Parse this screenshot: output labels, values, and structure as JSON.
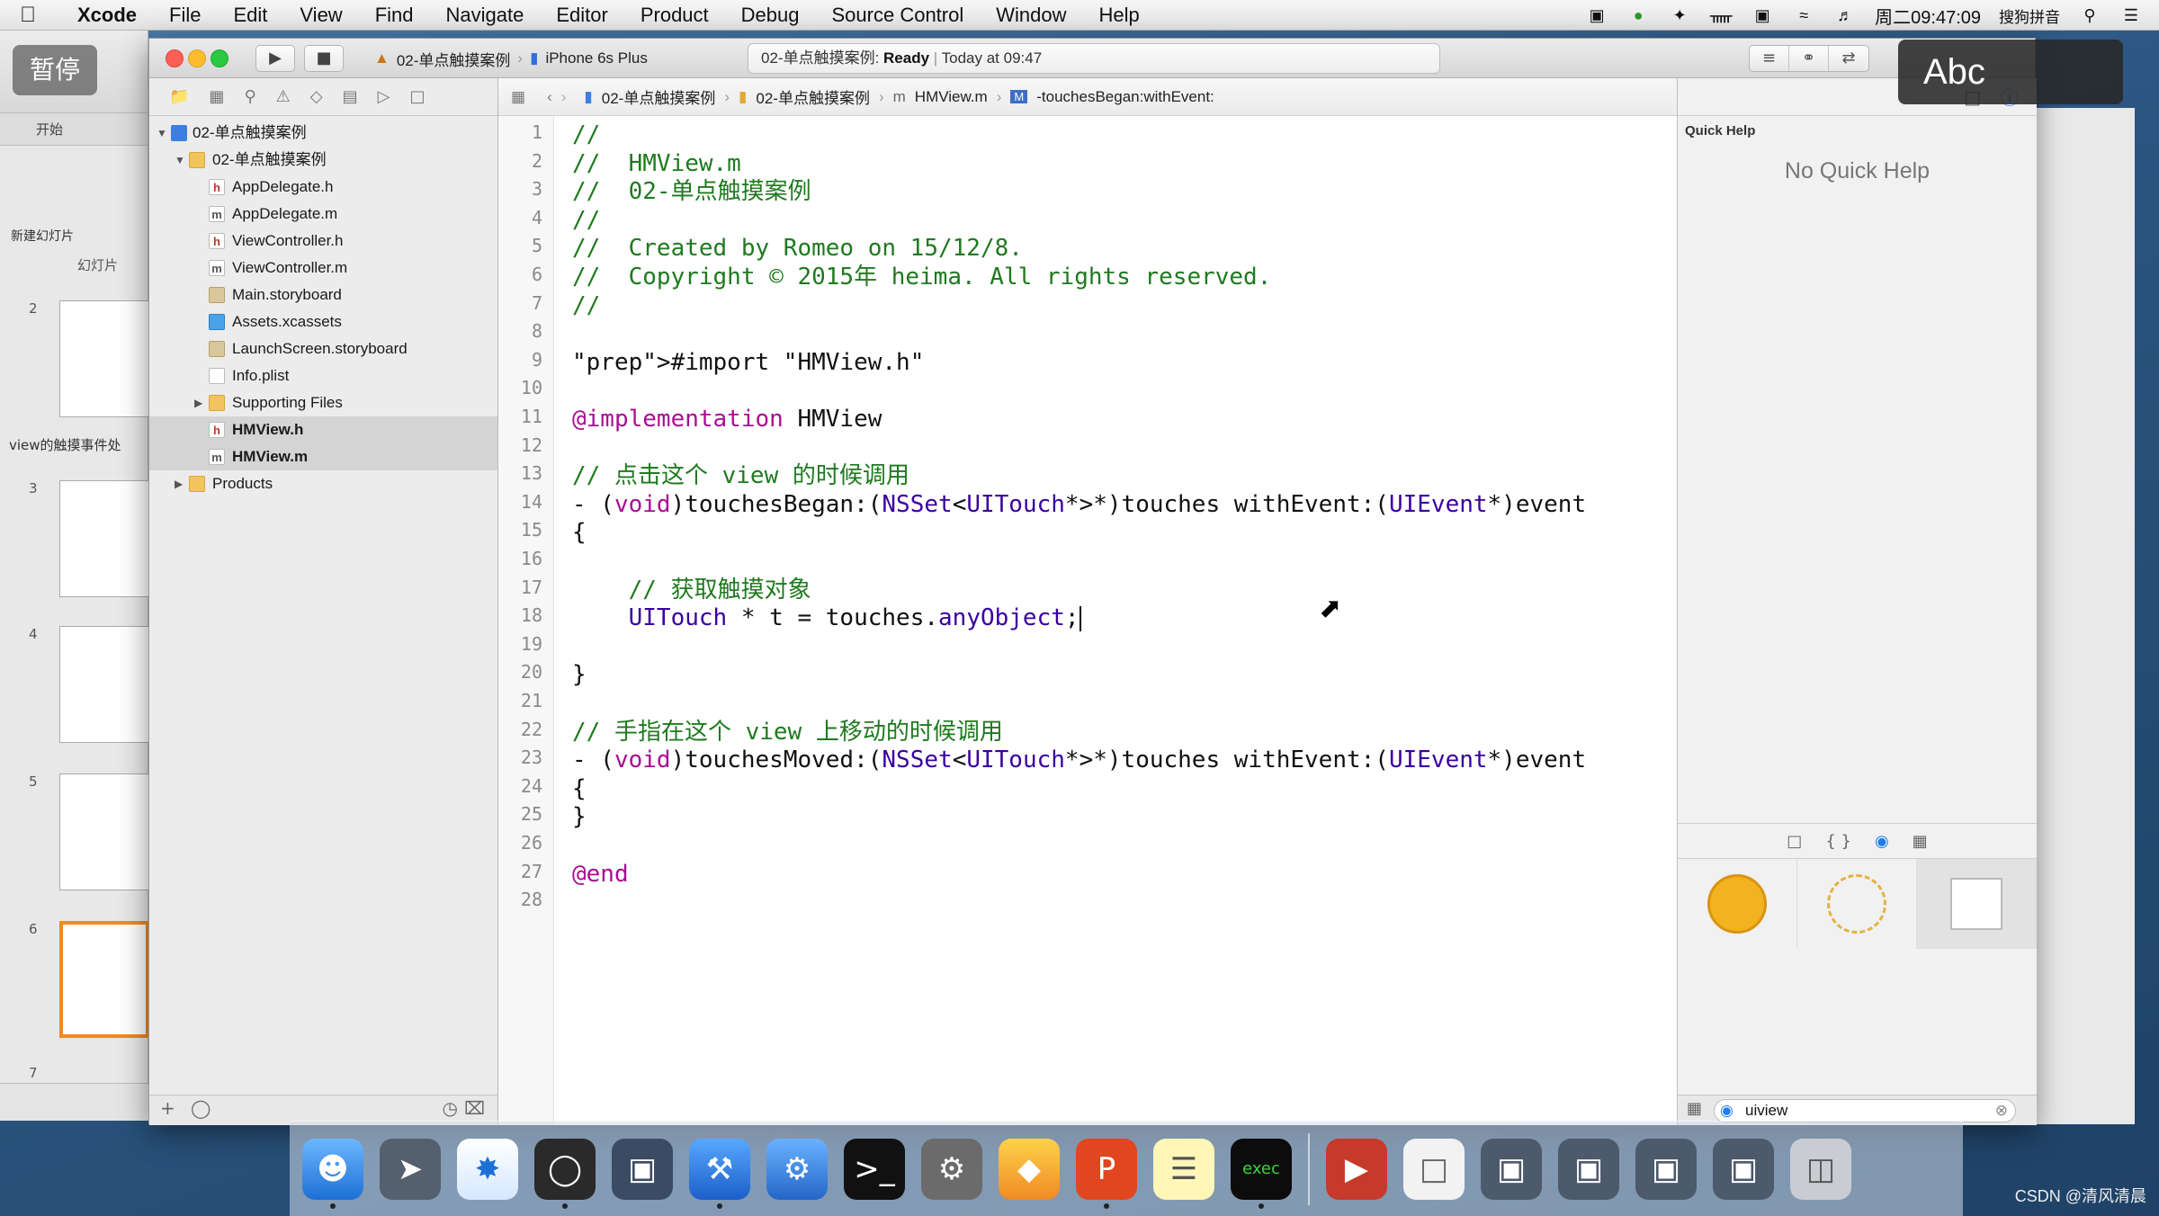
{
  "menubar": {
    "app": "Xcode",
    "items": [
      "File",
      "Edit",
      "View",
      "Find",
      "Navigate",
      "Editor",
      "Product",
      "Debug",
      "Source Control",
      "Window",
      "Help"
    ],
    "clock": "周二09:47:09",
    "input_method": "搜狗拼音"
  },
  "overlay": {
    "pause": "暂停",
    "abc": "Abc"
  },
  "keynote": {
    "tab_start": "开始",
    "tab_slides": "幻灯片",
    "new_slide": "新建幻灯片",
    "section_label": "view的触摸事件处",
    "slide_numbers": [
      "2",
      "3",
      "4",
      "5",
      "6",
      "7"
    ]
  },
  "toolbar": {
    "scheme": "02-单点触摸案例",
    "device": "iPhone 6s Plus",
    "status_project": "02-单点触摸案例:",
    "status_state": "Ready",
    "status_time": "Today at 09:47"
  },
  "jumpbar": [
    "02-单点触摸案例",
    "02-单点触摸案例",
    "HMView.m",
    "-touchesBegan:withEvent:"
  ],
  "navigator": {
    "project": "02-单点触摸案例",
    "group": "02-单点触摸案例",
    "files": [
      {
        "name": "AppDelegate.h",
        "type": "h"
      },
      {
        "name": "AppDelegate.m",
        "type": "m"
      },
      {
        "name": "ViewController.h",
        "type": "h"
      },
      {
        "name": "ViewController.m",
        "type": "m"
      },
      {
        "name": "Main.storyboard",
        "type": "sb"
      },
      {
        "name": "Assets.xcassets",
        "type": "xc"
      },
      {
        "name": "LaunchScreen.storyboard",
        "type": "sb"
      },
      {
        "name": "Info.plist",
        "type": "pl"
      },
      {
        "name": "Supporting Files",
        "type": "folder"
      },
      {
        "name": "HMView.h",
        "type": "h"
      },
      {
        "name": "HMView.m",
        "type": "m"
      }
    ],
    "products": "Products"
  },
  "editor": {
    "lines": [
      "//",
      "//  HMView.m",
      "//  02-单点触摸案例",
      "//",
      "//  Created by Romeo on 15/12/8.",
      "//  Copyright © 2015年 heima. All rights reserved.",
      "//",
      "",
      "#import \"HMView.h\"",
      "",
      "@implementation HMView",
      "",
      "// 点击这个 view 的时候调用",
      "- (void)touchesBegan:(NSSet<UITouch*>*)touches withEvent:(UIEvent*)event",
      "{",
      "",
      "    // 获取触摸对象",
      "    UITouch * t = touches.anyObject;",
      "",
      "}",
      "",
      "// 手指在这个 view 上移动的时候调用",
      "- (void)touchesMoved:(NSSet<UITouch*>*)touches withEvent:(UIEvent*)event",
      "{",
      "}",
      "",
      "@end",
      ""
    ]
  },
  "utilities": {
    "quick_help_title": "Quick Help",
    "no_quick_help": "No Quick Help",
    "filter_value": "uiview"
  },
  "watermark": "CSDN @清风清晨"
}
